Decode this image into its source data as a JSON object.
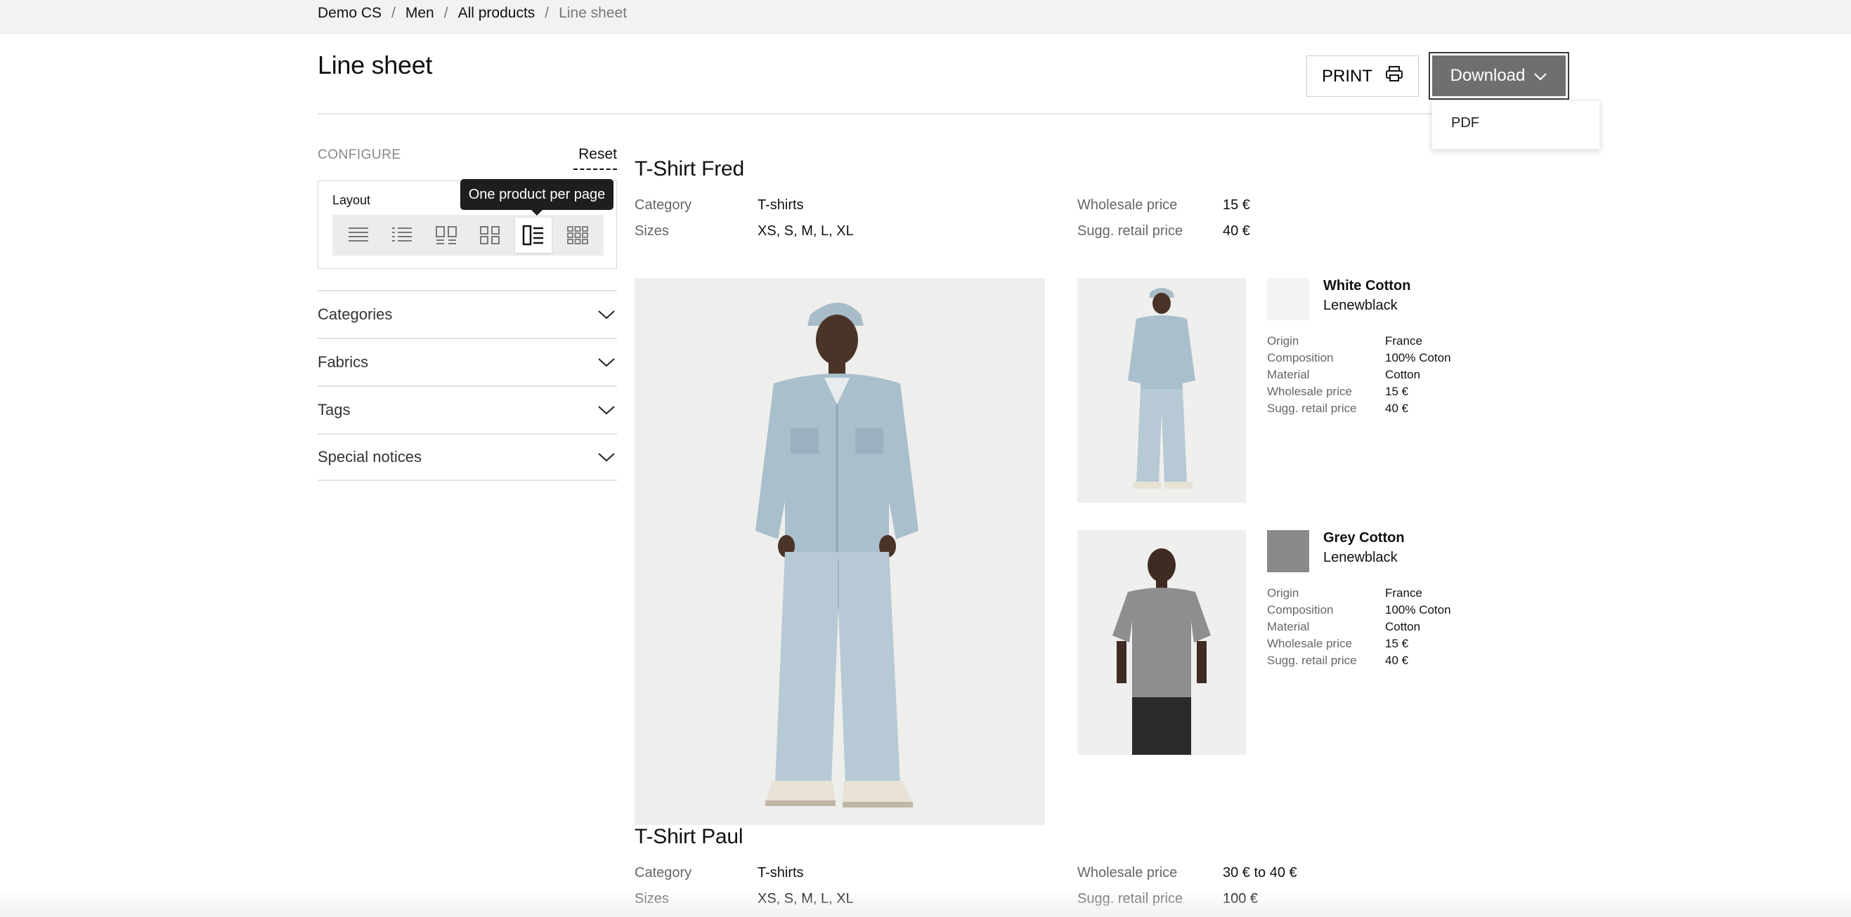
{
  "breadcrumb": {
    "items": [
      "Demo CS",
      "Men",
      "All products",
      "Line sheet"
    ],
    "separator": "/"
  },
  "page": {
    "title": "Line sheet"
  },
  "toolbar": {
    "print_label": "PRINT",
    "print_icon": "printer-icon",
    "download_label": "Download",
    "download_icon": "chevron-down-icon",
    "download_options": [
      "PDF"
    ]
  },
  "configure": {
    "label": "CONFIGURE",
    "reset_label": "Reset",
    "layout_label": "Layout",
    "layout_options": [
      "list-dense-icon",
      "list-bullets-icon",
      "grid-2-with-text-icon",
      "grid-2-icon",
      "one-per-page-icon",
      "grid-3-icon"
    ],
    "selected_layout": "one-per-page-icon",
    "tooltip": "One product per page"
  },
  "filters": [
    {
      "label": "Categories"
    },
    {
      "label": "Fabrics"
    },
    {
      "label": "Tags"
    },
    {
      "label": "Special notices"
    }
  ],
  "products": [
    {
      "name": "T-Shirt Fred",
      "category_label": "Category",
      "category": "T-shirts",
      "sizes_label": "Sizes",
      "sizes": "XS, S, M, L, XL",
      "wholesale_label": "Wholesale price",
      "wholesale": "15 €",
      "retail_label": "Sugg. retail price",
      "retail": "40 €",
      "variants": [
        {
          "name": "White Cotton",
          "brand": "Lenewblack",
          "swatch_color": "#f3f3f3",
          "specs": [
            {
              "k": "Origin",
              "v": "France"
            },
            {
              "k": "Composition",
              "v": "100% Coton"
            },
            {
              "k": "Material",
              "v": "Cotton"
            },
            {
              "k": "Wholesale price",
              "v": "15 €"
            },
            {
              "k": "Sugg. retail price",
              "v": "40 €"
            }
          ]
        },
        {
          "name": "Grey Cotton",
          "brand": "Lenewblack",
          "swatch_color": "#8a8a8a",
          "specs": [
            {
              "k": "Origin",
              "v": "France"
            },
            {
              "k": "Composition",
              "v": "100% Coton"
            },
            {
              "k": "Material",
              "v": "Cotton"
            },
            {
              "k": "Wholesale price",
              "v": "15 €"
            },
            {
              "k": "Sugg. retail price",
              "v": "40 €"
            }
          ]
        }
      ]
    },
    {
      "name": "T-Shirt Paul",
      "category_label": "Category",
      "category": "T-shirts",
      "sizes_label": "Sizes",
      "sizes": "XS, S, M, L, XL",
      "wholesale_label": "Wholesale price",
      "wholesale": "30 € to 40 €",
      "retail_label": "Sugg. retail price",
      "retail": "100 €"
    }
  ],
  "colors": {
    "denim": "#a9bfcc",
    "denim_dark": "#8fa7b6",
    "grey_tee": "#8e8e8e",
    "skin": "#4a3428",
    "button_bg": "#6f6f6f"
  }
}
